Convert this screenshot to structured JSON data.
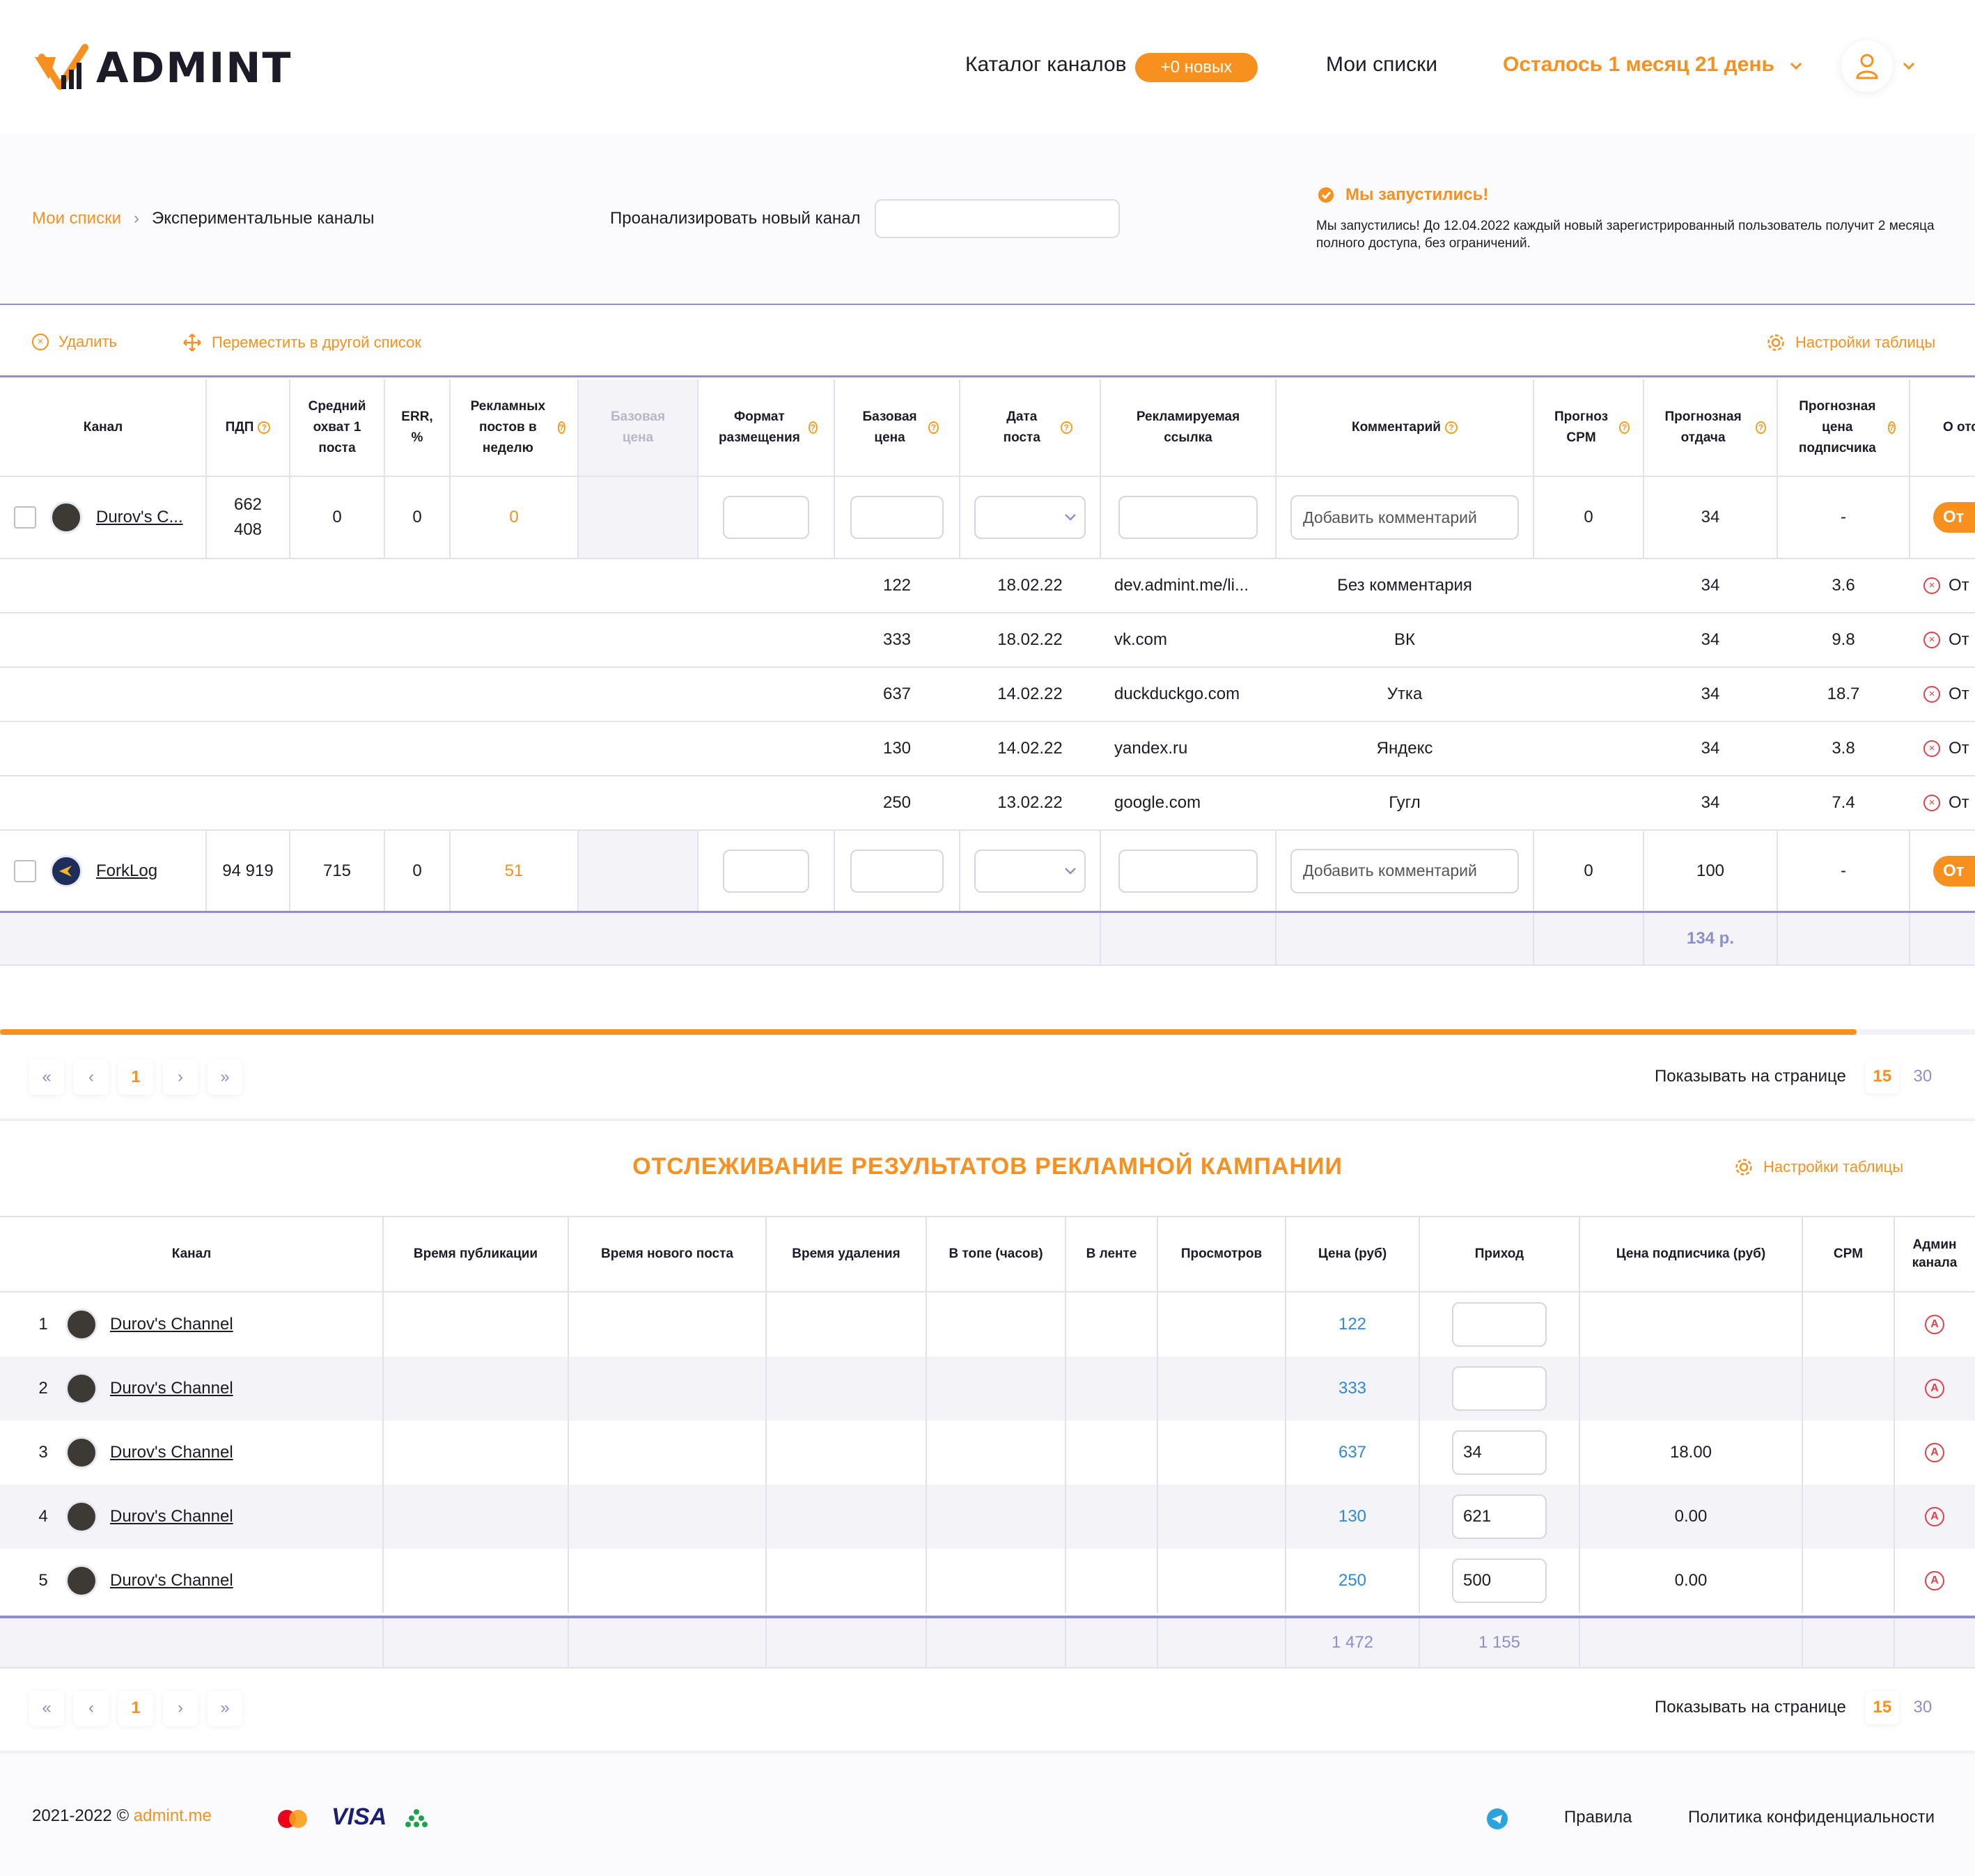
{
  "header": {
    "logo": "ADMINT",
    "nav_catalog": "Каталог каналов",
    "badge_new": "+0 новых",
    "nav_lists": "Мои списки",
    "subscription": "Осталось 1 месяц 21 день"
  },
  "breadcrumb": {
    "root": "Мои списки",
    "current": "Экспериментальные каналы"
  },
  "analyze": {
    "label": "Проанализировать новый канал",
    "value": ""
  },
  "launch": {
    "title": "Мы запустились!",
    "text": "Мы запустились! До 12.04.2022 каждый новый зарегистрированный пользователь получит 2 месяца полного доступа, без ограничений."
  },
  "actions": {
    "delete": "Удалить",
    "move": "Переместить в другой список",
    "settings": "Настройки таблицы"
  },
  "table1": {
    "headers": {
      "channel": "Канал",
      "pdp": "ПДП",
      "reach": "Средний охват 1 поста",
      "err": "ERR, %",
      "ads_per_week": "Рекламных постов в неделю",
      "base_price_disabled": "Базовая цена",
      "format": "Формат размещения",
      "base_price": "Базовая цена",
      "post_date": "Дата поста",
      "ad_link": "Рекламируемая ссылка",
      "comment": "Комментарий",
      "cpm_forecast": "Прогноз CPM",
      "return_forecast": "Прогнозная отдача",
      "sub_price_forecast": "Прогнозная цена подписчика",
      "track_partial": "О отсл"
    },
    "channels": [
      {
        "name": "Durov's C...",
        "pdp": "662 408",
        "reach": "0",
        "err": "0",
        "ads_per_week": "0",
        "comment_placeholder": "Добавить комментарий",
        "cpm": "0",
        "return": "34",
        "sub_price": "-",
        "track_button": "От"
      },
      {
        "name": "ForkLog",
        "pdp": "94 919",
        "reach": "715",
        "err": "0",
        "ads_per_week": "51",
        "comment_placeholder": "Добавить комментарий",
        "cpm": "0",
        "return": "100",
        "sub_price": "-",
        "track_button": "От"
      }
    ],
    "placements": [
      {
        "price": "122",
        "date": "18.02.22",
        "link": "dev.admint.me/li...",
        "comment": "Без комментария",
        "return": "34",
        "sub_price": "3.6",
        "action": "От"
      },
      {
        "price": "333",
        "date": "18.02.22",
        "link": "vk.com",
        "comment": "ВК",
        "return": "34",
        "sub_price": "9.8",
        "action": "От"
      },
      {
        "price": "637",
        "date": "14.02.22",
        "link": "duckduckgo.com",
        "comment": "Утка",
        "return": "34",
        "sub_price": "18.7",
        "action": "От"
      },
      {
        "price": "130",
        "date": "14.02.22",
        "link": "yandex.ru",
        "comment": "Яндекс",
        "return": "34",
        "sub_price": "3.8",
        "action": "От"
      },
      {
        "price": "250",
        "date": "13.02.22",
        "link": "google.com",
        "comment": "Гугл",
        "return": "34",
        "sub_price": "7.4",
        "action": "От"
      }
    ],
    "total_return": "134 р.",
    "scroll_progress": 0.94
  },
  "pager1": {
    "first": "«",
    "prev": "‹",
    "page": "1",
    "next": "›",
    "last": "»",
    "per_page_label": "Показывать на странице",
    "per_page_15": "15",
    "per_page_30": "30"
  },
  "table2": {
    "title": "ОТСЛЕЖИВАНИЕ РЕЗУЛЬТАТОВ РЕКЛАМНОЙ КАМПАНИИ",
    "settings": "Настройки таблицы",
    "headers": {
      "channel": "Канал",
      "pub_time": "Время публикации",
      "new_post_time": "Время нового поста",
      "delete_time": "Время удаления",
      "top_hours": "В топе (часов)",
      "in_feed": "В ленте",
      "views": "Просмотров",
      "price": "Цена (руб)",
      "income": "Приход",
      "sub_price": "Цена подписчика (руб)",
      "cpm": "CPM",
      "admin": "Админ канала"
    },
    "rows": [
      {
        "n": "1",
        "channel": "Durov's Channel",
        "price": "122",
        "income": "",
        "sub_price": ""
      },
      {
        "n": "2",
        "channel": "Durov's Channel",
        "price": "333",
        "income": "",
        "sub_price": ""
      },
      {
        "n": "3",
        "channel": "Durov's Channel",
        "price": "637",
        "income": "34",
        "sub_price": "18.00"
      },
      {
        "n": "4",
        "channel": "Durov's Channel",
        "price": "130",
        "income": "621",
        "sub_price": "0.00"
      },
      {
        "n": "5",
        "channel": "Durov's Channel",
        "price": "250",
        "income": "500",
        "sub_price": "0.00"
      }
    ],
    "total_price": "1 472",
    "total_income": "1 155"
  },
  "pager2": {
    "first": "«",
    "prev": "‹",
    "page": "1",
    "next": "›",
    "last": "»",
    "per_page_label": "Показывать на странице",
    "per_page_15": "15",
    "per_page_30": "30"
  },
  "footer": {
    "copyright": "2021-2022 ©",
    "site": "admint.me",
    "visa": "VISA",
    "rules": "Правила",
    "privacy": "Политика конфиденциальности"
  },
  "colors": {
    "accent": "#f7901e",
    "divider": "#8d8fc8",
    "price_blue": "#2d8ad6",
    "danger": "#e4404a"
  }
}
